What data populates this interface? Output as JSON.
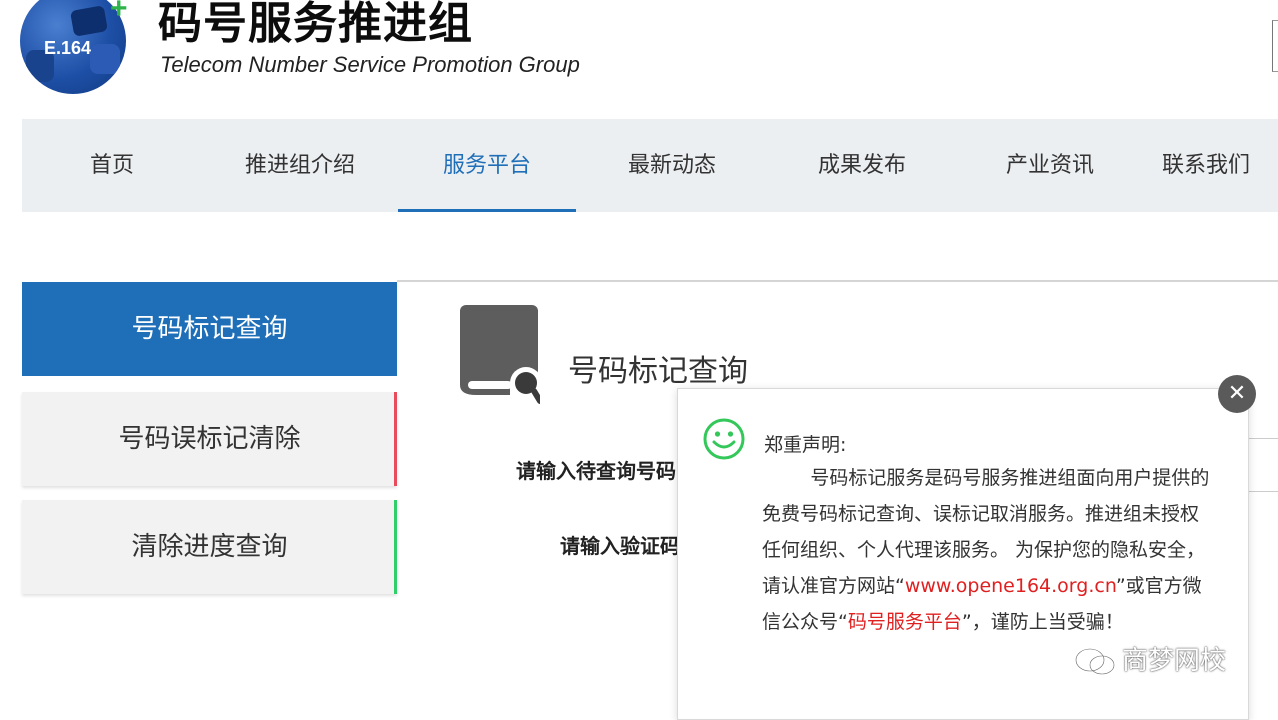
{
  "header": {
    "logo_text": "E.164",
    "title": "码号服务推进组",
    "subtitle": "Telecom Number Service  Promotion Group"
  },
  "nav": {
    "items": [
      {
        "label": "首页"
      },
      {
        "label": "推进组介绍"
      },
      {
        "label": "服务平台"
      },
      {
        "label": "最新动态"
      },
      {
        "label": "成果发布"
      },
      {
        "label": "产业资讯"
      },
      {
        "label": "联系我们"
      }
    ],
    "active_index": 2
  },
  "sidebar": {
    "items": [
      {
        "label": "号码标记查询",
        "active": true
      },
      {
        "label": "号码误标记清除",
        "accent": "#e84b5b"
      },
      {
        "label": "清除进度查询",
        "accent": "#2fcf6a"
      }
    ]
  },
  "main": {
    "title": "号码标记查询",
    "form": {
      "number_label": "请输入待查询号码",
      "captcha_label": "请输入验证码"
    }
  },
  "modal": {
    "close_glyph": "✕",
    "heading": "郑重声明:",
    "body_pre": "        号码标记服务是码号服务推进组面向用户提供的免费号码标记查询、误标记取消服务。推进组未授权任何组织、个人代理该服务。 为保护您的隐私安全，请认准官方网站“",
    "url": "www.opene164.org.cn",
    "body_mid": "”或官方微信公众号“",
    "wechat_name": "码号服务平台",
    "body_post": "”，谨防上当受骗！"
  },
  "watermark": {
    "text": "商梦网校"
  },
  "colors": {
    "brand_blue": "#1f6fb8",
    "nav_bg": "#eceff2",
    "warning_red": "#e02020",
    "accent_red": "#e84b5b",
    "accent_green": "#2fcf6a"
  }
}
